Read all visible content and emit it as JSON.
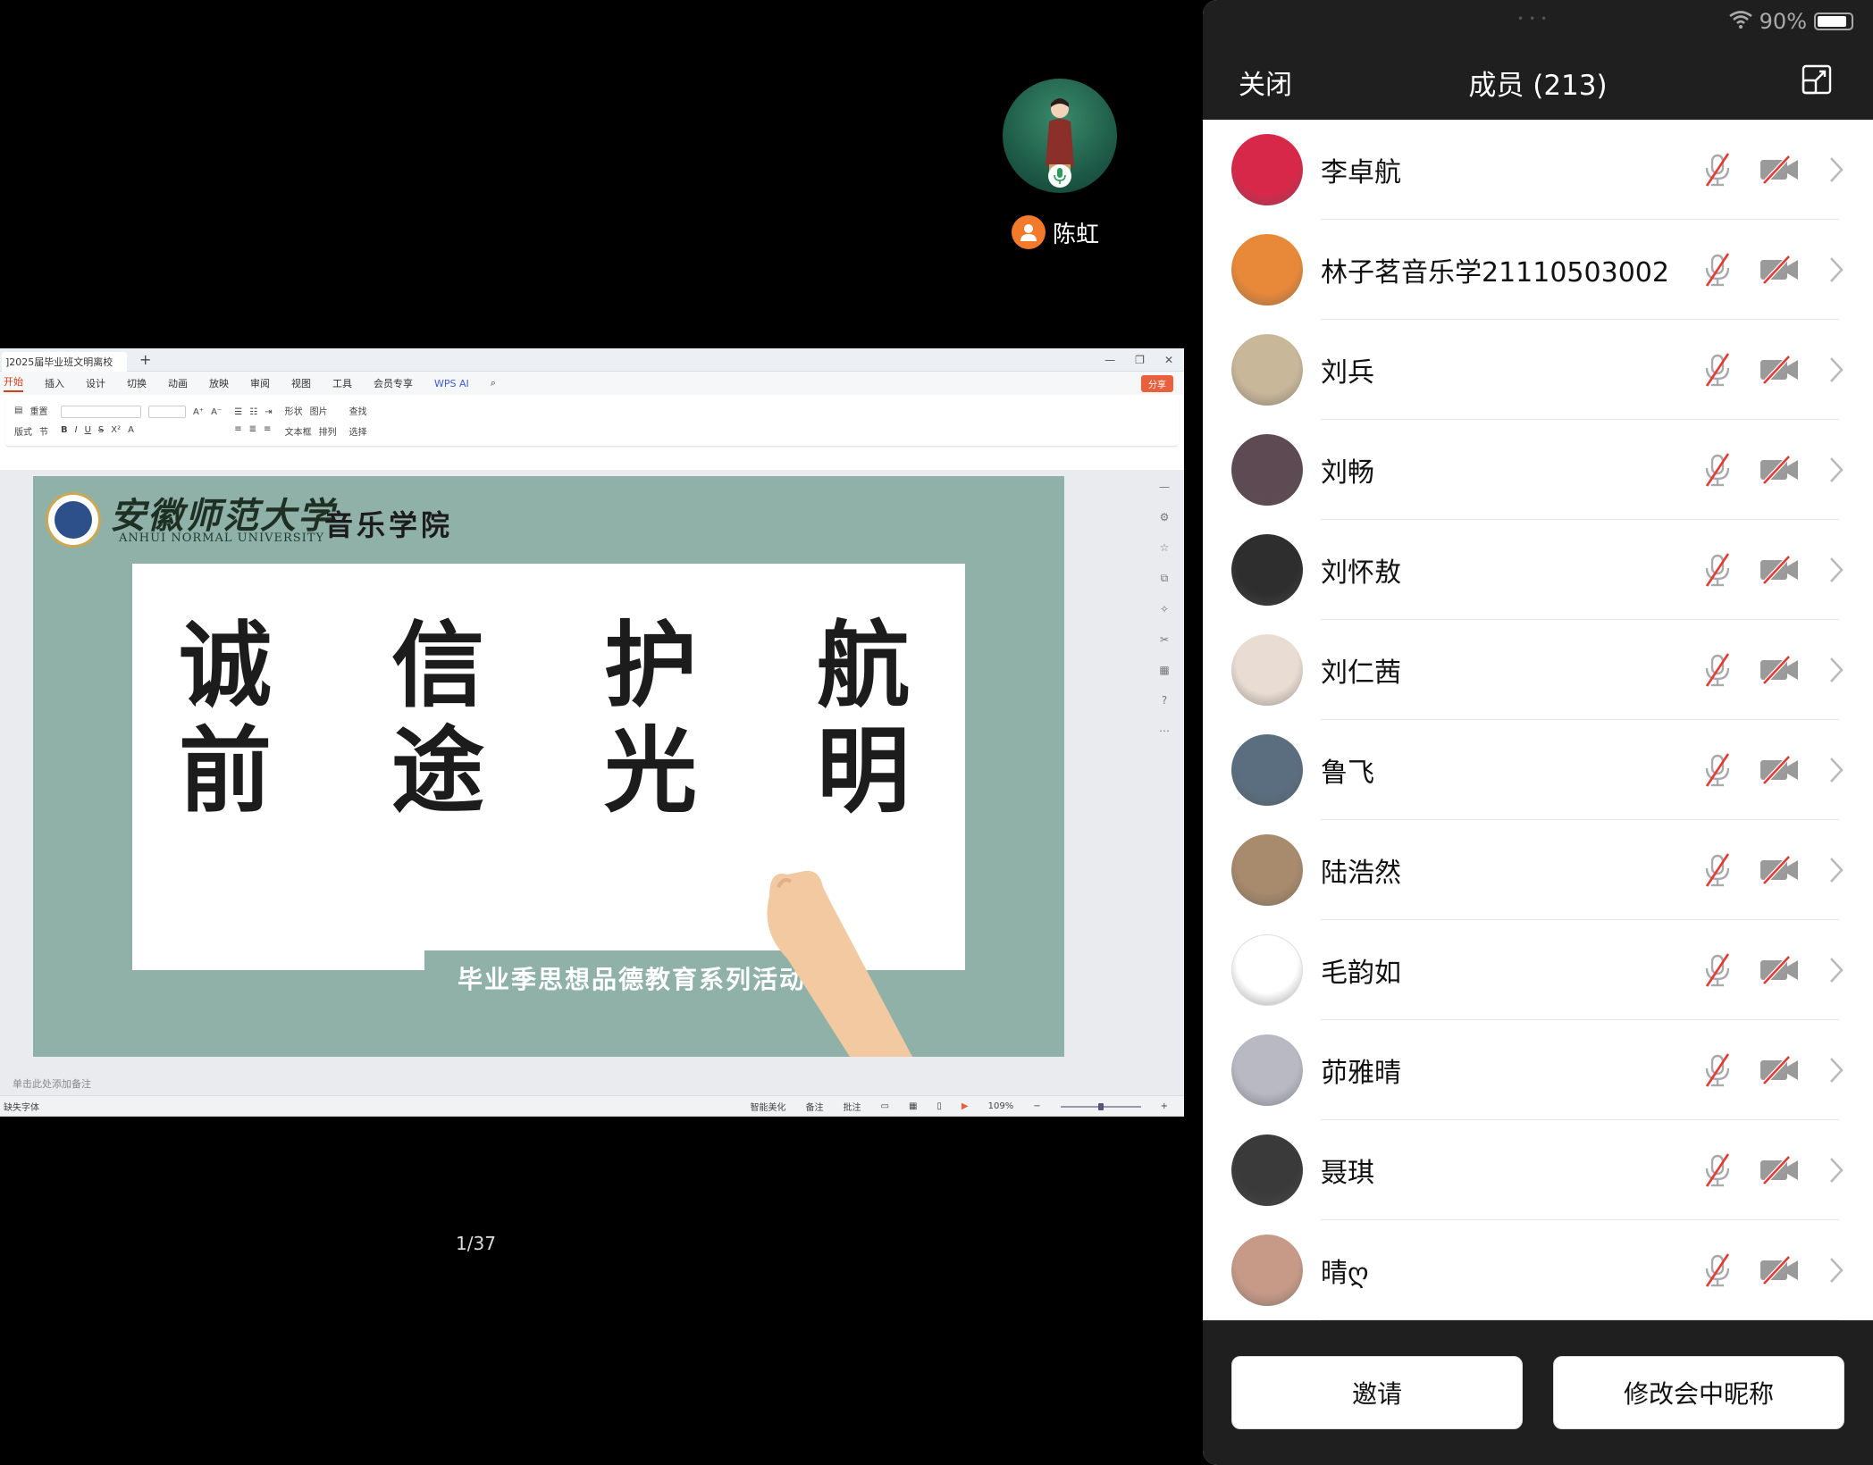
{
  "speaker": {
    "name": "陈虹"
  },
  "screen_share": {
    "tab_title": "]2025届毕业班文明离校",
    "menu": [
      "开始",
      "插入",
      "设计",
      "切换",
      "动画",
      "放映",
      "审阅",
      "视图",
      "工具",
      "会员专享",
      "WPS AI"
    ],
    "share_label": "分享",
    "ribbon": {
      "layout": "版式",
      "reset": "重置",
      "section": "节",
      "shape": "形状",
      "picture": "图片",
      "find": "查找",
      "textbox": "文本框",
      "arrange": "排列",
      "select": "选择"
    },
    "slide": {
      "university_cn": "安徽师范大学",
      "university_en": "ANHUI NORMAL UNIVERSITY",
      "college": "音乐学院",
      "chars": [
        "诚",
        "信",
        "护",
        "航",
        "前",
        "途",
        "光",
        "明"
      ],
      "banner": "毕业季思想品德教育系列活动"
    },
    "notes_placeholder": "单击此处添加备注",
    "status": {
      "missing_font": "缺失字体",
      "beautify": "智能美化",
      "notes": "备注",
      "comment": "批注",
      "zoom": "109%"
    },
    "page_indicator": "1/37"
  },
  "panel": {
    "battery": "90%",
    "close_label": "关闭",
    "title": "成员 (213)",
    "members": [
      {
        "name": "李卓航",
        "avatar_color": "#d8284a"
      },
      {
        "name": "林子茗音乐学21110503002",
        "avatar_color": "#e8893a"
      },
      {
        "name": "刘兵",
        "avatar_color": "#c9b79a"
      },
      {
        "name": "刘畅",
        "avatar_color": "#5e4a52"
      },
      {
        "name": "刘怀敖",
        "avatar_color": "#2e2e2e"
      },
      {
        "name": "刘仁茜",
        "avatar_color": "#e9dcd2"
      },
      {
        "name": "鲁飞",
        "avatar_color": "#5a6e80"
      },
      {
        "name": "陆浩然",
        "avatar_color": "#a88a6c"
      },
      {
        "name": "毛韵如",
        "avatar_color": "#ffffff"
      },
      {
        "name": "茆雅晴",
        "avatar_color": "#b9b9c4"
      },
      {
        "name": "聂琪",
        "avatar_color": "#3a3a3a"
      },
      {
        "name": "晴ღ",
        "avatar_color": "#c79a88"
      }
    ],
    "invite_label": "邀请",
    "rename_label": "修改会中昵称"
  }
}
